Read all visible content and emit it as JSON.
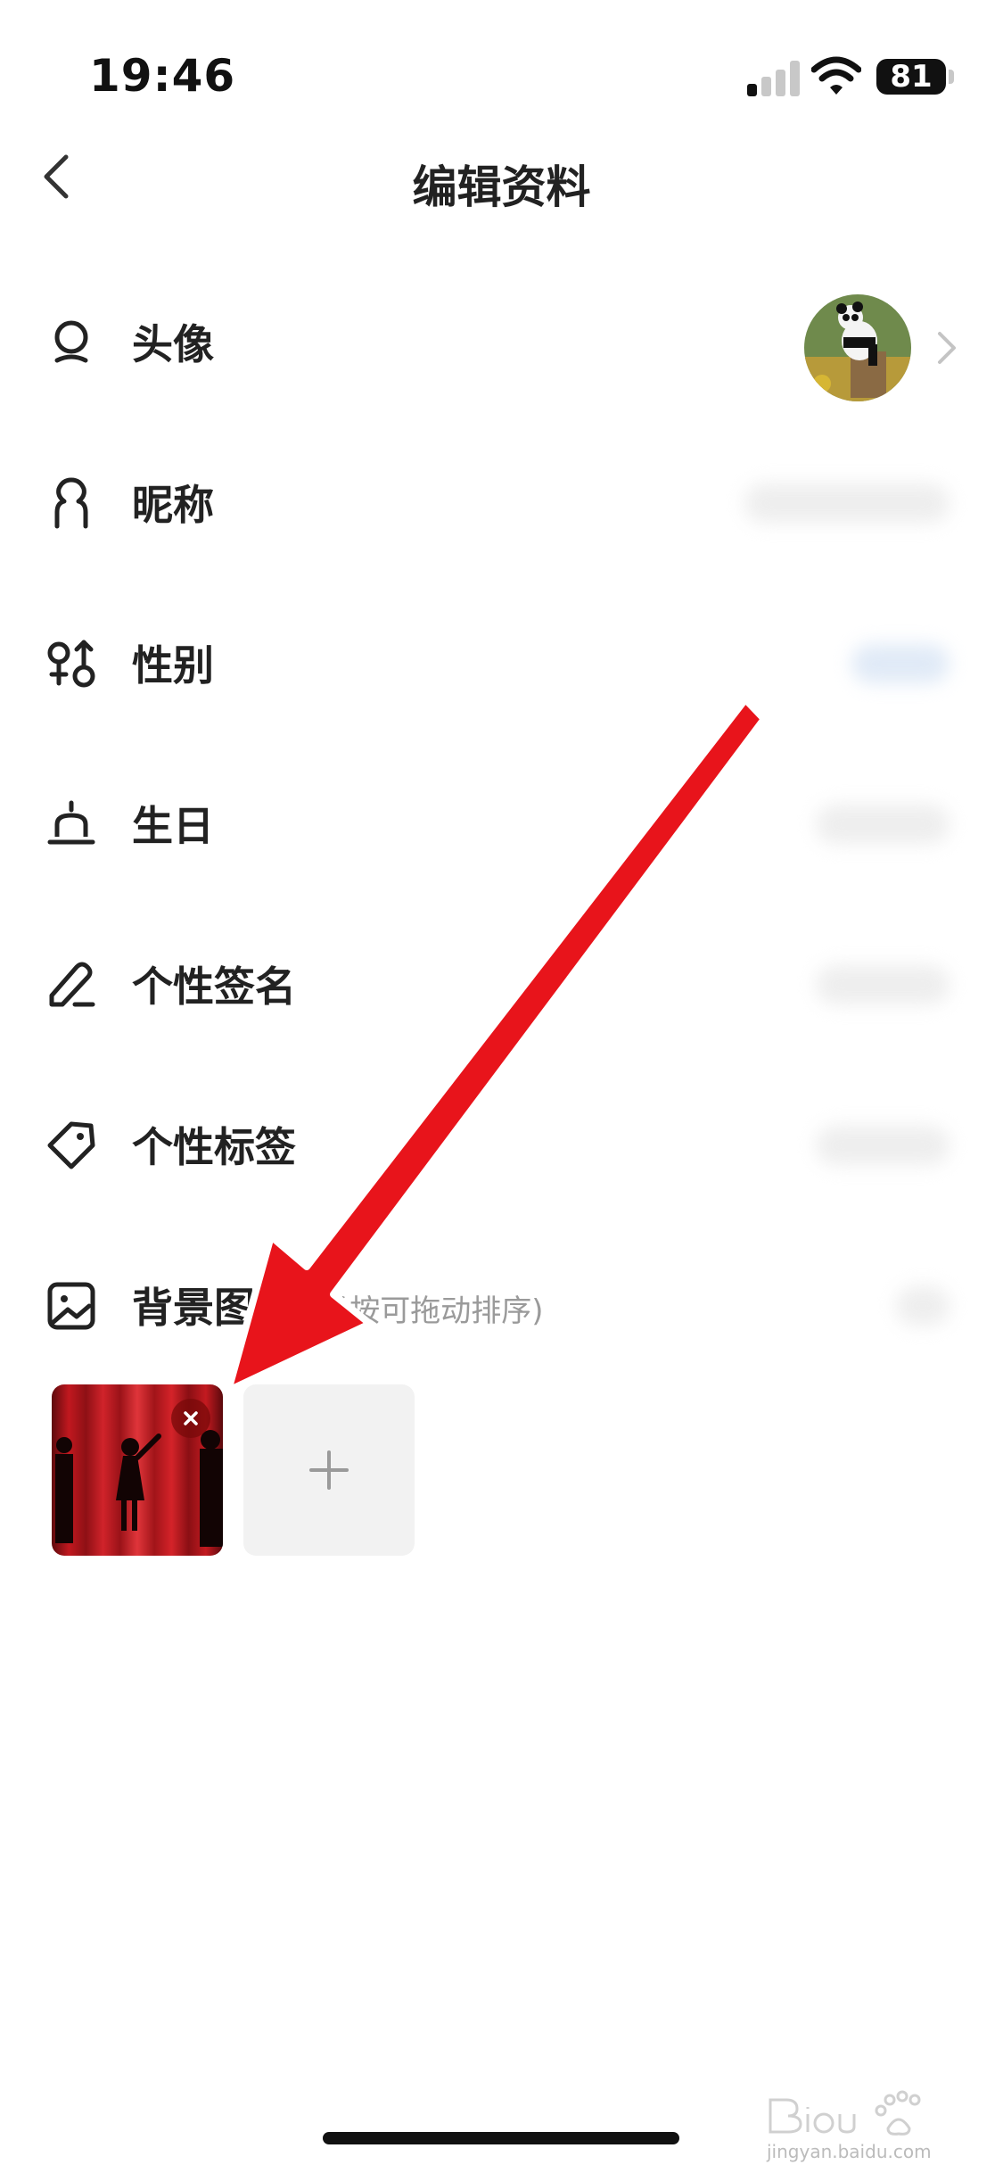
{
  "status_bar": {
    "time": "19:46",
    "battery": "81"
  },
  "nav": {
    "title": "编辑资料"
  },
  "rows": [
    {
      "id": "avatar",
      "label": "头像",
      "icon": "avatar-icon"
    },
    {
      "id": "nickname",
      "label": "昵称",
      "icon": "person-icon"
    },
    {
      "id": "gender",
      "label": "性别",
      "icon": "gender-icon"
    },
    {
      "id": "birthday",
      "label": "生日",
      "icon": "cake-icon"
    },
    {
      "id": "signature",
      "label": "个性签名",
      "icon": "pen-icon"
    },
    {
      "id": "tags",
      "label": "个性标签",
      "icon": "tag-icon"
    },
    {
      "id": "background",
      "label": "背景图",
      "hint": "(长按可拖动排序)",
      "icon": "image-icon"
    }
  ],
  "background_images": {
    "add_label": "+"
  },
  "watermark": {
    "caption": "jingyan.baidu.com"
  },
  "colors": {
    "annotation_arrow": "#e8141b",
    "curtain": "#b3161b"
  }
}
